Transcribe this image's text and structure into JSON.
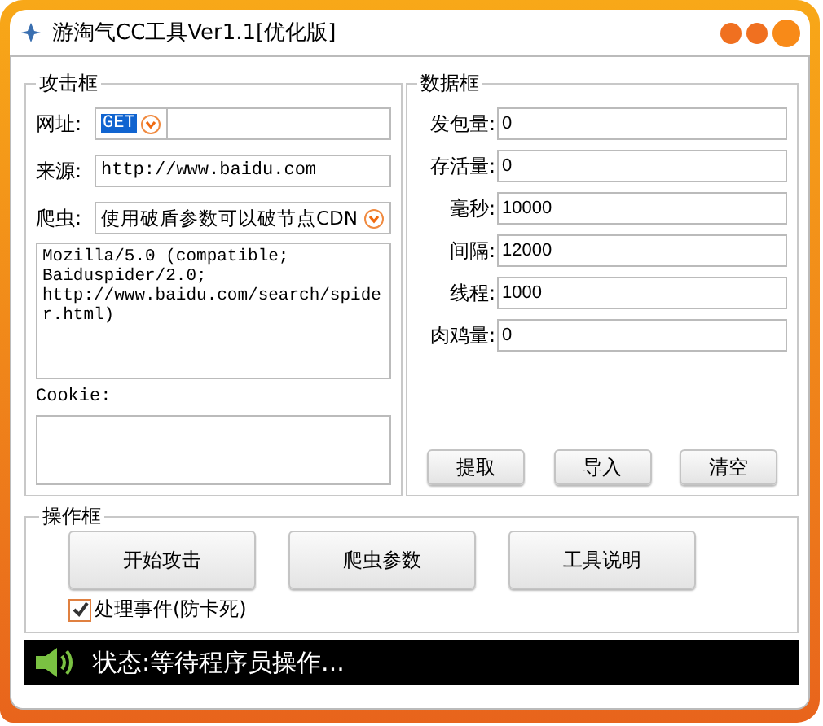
{
  "window": {
    "title": "游淘气CC工具Ver1.1[优化版]"
  },
  "attack": {
    "title": "攻击框",
    "url": {
      "label": "网址:",
      "method": "GET"
    },
    "referer": {
      "label": "来源:",
      "value": "http://www.baidu.com"
    },
    "spider": {
      "label": "爬虫:",
      "value": "使用破盾参数可以破节点CDN"
    },
    "user_agent": "Mozilla/5.0 (compatible; Baiduspider/2.0; http://www.baidu.com/search/spider.html)",
    "cookie": {
      "label": "Cookie:"
    }
  },
  "data": {
    "title": "数据框",
    "fields": [
      {
        "label": "发包量:",
        "value": "0"
      },
      {
        "label": "存活量:",
        "value": "0"
      },
      {
        "label": "毫秒:",
        "value": "10000"
      },
      {
        "label": "间隔:",
        "value": "12000"
      },
      {
        "label": "线程:",
        "value": "1000"
      },
      {
        "label": "肉鸡量:",
        "value": "0"
      }
    ],
    "buttons": [
      "提取",
      "导入",
      "清空"
    ]
  },
  "operation": {
    "title": "操作框",
    "buttons": [
      "开始攻击",
      "爬虫参数",
      "工具说明"
    ],
    "checkbox": {
      "label": "处理事件(防卡死)",
      "checked": true
    }
  },
  "status": "状态:等待程序员操作..."
}
